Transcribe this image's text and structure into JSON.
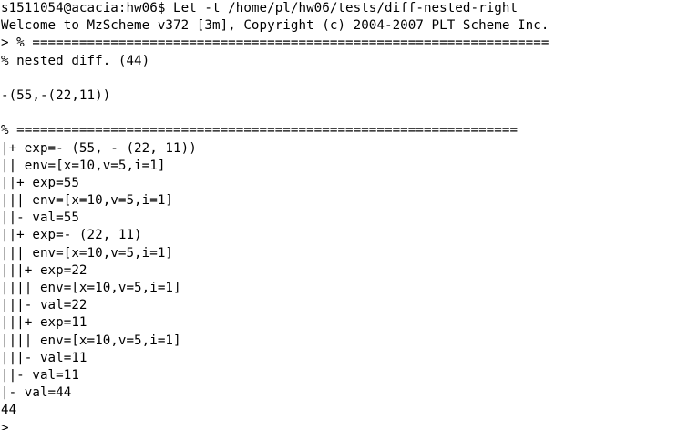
{
  "terminal": {
    "background": "#ffffff",
    "foreground": "#000000",
    "lines": [
      "s1511054@acacia:hw06$ Let -t /home/pl/hw06/tests/diff-nested-right",
      "Welcome to MzScheme v372 [3m], Copyright (c) 2004-2007 PLT Scheme Inc.",
      "> % ==================================================================",
      "% nested diff. (44)",
      "",
      "-(55,-(22,11))",
      "",
      "% ================================================================",
      "|+ exp=- (55, - (22, 11))",
      "|| env=[x=10,v=5,i=1]",
      "||+ exp=55",
      "||| env=[x=10,v=5,i=1]",
      "||- val=55",
      "||+ exp=- (22, 11)",
      "||| env=[x=10,v=5,i=1]",
      "|||+ exp=22",
      "|||| env=[x=10,v=5,i=1]",
      "|||- val=22",
      "|||+ exp=11",
      "|||| env=[x=10,v=5,i=1]",
      "|||- val=11",
      "||- val=11",
      "|- val=44",
      "44",
      ">"
    ]
  }
}
